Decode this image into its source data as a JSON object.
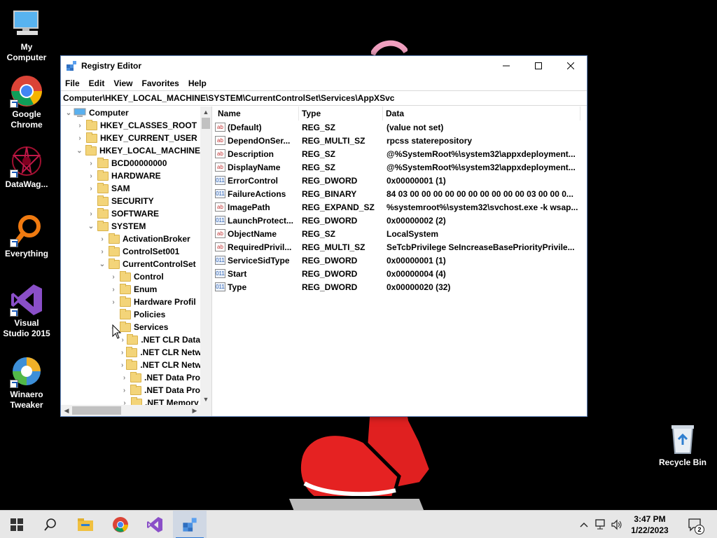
{
  "desktop": {
    "icons": [
      {
        "label_line1": "My",
        "label_line2": "Computer"
      },
      {
        "label_line1": "Google",
        "label_line2": "Chrome"
      },
      {
        "label_line1": "DataWag...",
        "label_line2": ""
      },
      {
        "label_line1": "Everything",
        "label_line2": ""
      },
      {
        "label_line1": "Visual",
        "label_line2": "Studio 2015"
      },
      {
        "label_line1": "Winaero",
        "label_line2": "Tweaker"
      },
      {
        "label_line1": "Recycle Bin",
        "label_line2": ""
      }
    ]
  },
  "window": {
    "title": "Registry Editor",
    "menu": [
      "File",
      "Edit",
      "View",
      "Favorites",
      "Help"
    ],
    "address": "Computer\\HKEY_LOCAL_MACHINE\\SYSTEM\\CurrentControlSet\\Services\\AppXSvc",
    "tree": [
      {
        "label": "Computer",
        "depth": 0,
        "expander": "expanded",
        "icon": "computer-icon"
      },
      {
        "label": "HKEY_CLASSES_ROOT",
        "depth": 1,
        "expander": "collapsed"
      },
      {
        "label": "HKEY_CURRENT_USER",
        "depth": 1,
        "expander": "collapsed"
      },
      {
        "label": "HKEY_LOCAL_MACHINE",
        "depth": 1,
        "expander": "expanded"
      },
      {
        "label": "BCD00000000",
        "depth": 2,
        "expander": "collapsed"
      },
      {
        "label": "HARDWARE",
        "depth": 2,
        "expander": "collapsed"
      },
      {
        "label": "SAM",
        "depth": 2,
        "expander": "collapsed"
      },
      {
        "label": "SECURITY",
        "depth": 2,
        "expander": "none"
      },
      {
        "label": "SOFTWARE",
        "depth": 2,
        "expander": "collapsed"
      },
      {
        "label": "SYSTEM",
        "depth": 2,
        "expander": "expanded"
      },
      {
        "label": "ActivationBroker",
        "depth": 3,
        "expander": "collapsed"
      },
      {
        "label": "ControlSet001",
        "depth": 3,
        "expander": "collapsed"
      },
      {
        "label": "CurrentControlSet",
        "depth": 3,
        "expander": "expanded"
      },
      {
        "label": "Control",
        "depth": 4,
        "expander": "collapsed"
      },
      {
        "label": "Enum",
        "depth": 4,
        "expander": "collapsed"
      },
      {
        "label": "Hardware Profil",
        "depth": 4,
        "expander": "collapsed"
      },
      {
        "label": "Policies",
        "depth": 4,
        "expander": "none"
      },
      {
        "label": "Services",
        "depth": 4,
        "expander": "expanded"
      },
      {
        "label": ".NET CLR Data",
        "depth": 5,
        "expander": "collapsed"
      },
      {
        "label": ".NET CLR Netw",
        "depth": 5,
        "expander": "collapsed"
      },
      {
        "label": ".NET CLR Netw",
        "depth": 5,
        "expander": "collapsed"
      },
      {
        "label": ".NET Data Pro",
        "depth": 5,
        "expander": "collapsed"
      },
      {
        "label": ".NET Data Pro",
        "depth": 5,
        "expander": "collapsed"
      },
      {
        "label": ".NET Memory",
        "depth": 5,
        "expander": "collapsed"
      }
    ],
    "columns": {
      "name": "Name",
      "type": "Type",
      "data": "Data"
    },
    "values": [
      {
        "name": "(Default)",
        "type": "REG_SZ",
        "data": "(value not set)",
        "kind": "sz"
      },
      {
        "name": "DependOnSer...",
        "type": "REG_MULTI_SZ",
        "data": "rpcss staterepository",
        "kind": "sz"
      },
      {
        "name": "Description",
        "type": "REG_SZ",
        "data": "@%SystemRoot%\\system32\\appxdeployment...",
        "kind": "sz"
      },
      {
        "name": "DisplayName",
        "type": "REG_SZ",
        "data": "@%SystemRoot%\\system32\\appxdeployment...",
        "kind": "sz"
      },
      {
        "name": "ErrorControl",
        "type": "REG_DWORD",
        "data": "0x00000001 (1)",
        "kind": "bin"
      },
      {
        "name": "FailureActions",
        "type": "REG_BINARY",
        "data": "84 03 00 00 00 00 00 00 00 00 00 00 03 00 00 0...",
        "kind": "bin"
      },
      {
        "name": "ImagePath",
        "type": "REG_EXPAND_SZ",
        "data": "%systemroot%\\system32\\svchost.exe -k wsap...",
        "kind": "sz"
      },
      {
        "name": "LaunchProtect...",
        "type": "REG_DWORD",
        "data": "0x00000002 (2)",
        "kind": "bin"
      },
      {
        "name": "ObjectName",
        "type": "REG_SZ",
        "data": "LocalSystem",
        "kind": "sz"
      },
      {
        "name": "RequiredPrivil...",
        "type": "REG_MULTI_SZ",
        "data": "SeTcbPrivilege SeIncreaseBasePriorityPrivile...",
        "kind": "sz"
      },
      {
        "name": "ServiceSidType",
        "type": "REG_DWORD",
        "data": "0x00000001 (1)",
        "kind": "bin"
      },
      {
        "name": "Start",
        "type": "REG_DWORD",
        "data": "0x00000004 (4)",
        "kind": "bin"
      },
      {
        "name": "Type",
        "type": "REG_DWORD",
        "data": "0x00000020 (32)",
        "kind": "bin"
      }
    ]
  },
  "taskbar": {
    "time": "3:47 PM",
    "date": "1/22/2023",
    "notification_count": "2"
  },
  "icons": {
    "sz_value": "ab",
    "bin_value": "011"
  },
  "colors": {
    "taskbar": "#e7e7e7",
    "accent": "#2b78d4",
    "folder": "#f3d479"
  }
}
